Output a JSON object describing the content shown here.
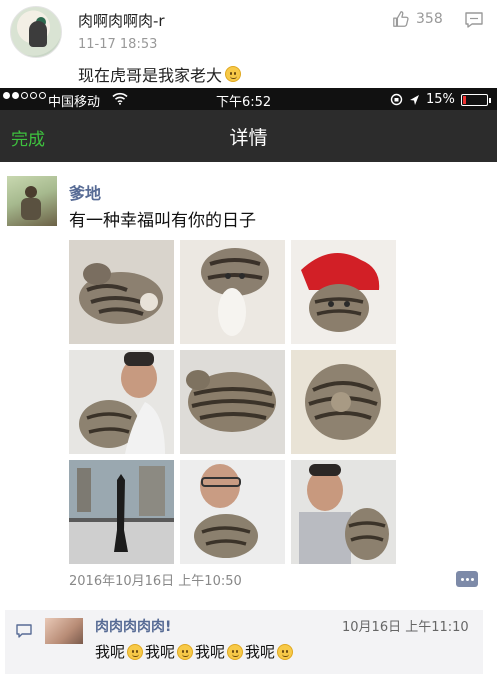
{
  "top_comment": {
    "username": "肉啊肉啊肉-r",
    "timestamp": "11-17 18:53",
    "likes": "358",
    "text": "现在虎哥是我家老大",
    "emoji": "smile-emoji"
  },
  "status_bar": {
    "carrier": "中国移动",
    "time": "下午6:52",
    "battery": "15%",
    "battery_level": 0.15,
    "battery_color": "#ee3333"
  },
  "nav": {
    "done_label": "完成",
    "title": "详情",
    "done_color": "#3ec13e"
  },
  "post": {
    "author": "爹地",
    "text": "有一种幸福叫有你的日子",
    "date": "2016年10月16日 上午10:50",
    "photo_count": 9
  },
  "comment": {
    "author": "肉肉肉肉肉!",
    "time": "10月16日 上午11:10",
    "segments": [
      "我呢",
      "我呢",
      "我呢",
      "我呢"
    ]
  },
  "colors": {
    "link": "#576b95",
    "navbar": "#2c2c2c"
  }
}
